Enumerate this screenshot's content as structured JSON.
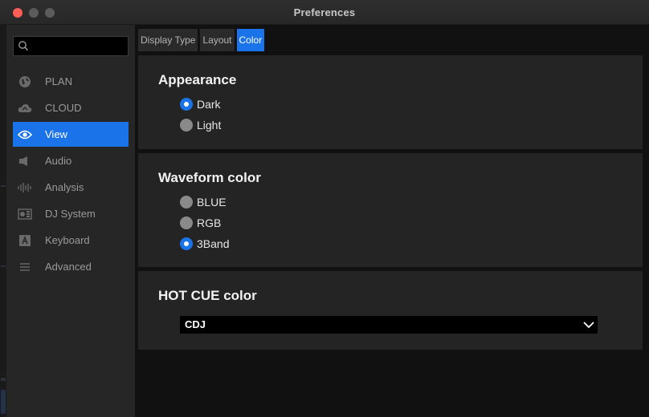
{
  "window": {
    "title": "Preferences"
  },
  "sidebar": {
    "search": {
      "placeholder": "",
      "value": ""
    },
    "items": [
      {
        "label": "PLAN",
        "icon": "globe-icon",
        "active": false
      },
      {
        "label": "CLOUD",
        "icon": "cloud-icon",
        "active": false
      },
      {
        "label": "View",
        "icon": "eye-icon",
        "active": true
      },
      {
        "label": "Audio",
        "icon": "speaker-icon",
        "active": false
      },
      {
        "label": "Analysis",
        "icon": "waveform-icon",
        "active": false
      },
      {
        "label": "DJ System",
        "icon": "dj-device-icon",
        "active": false
      },
      {
        "label": "Keyboard",
        "icon": "keyboard-key-icon",
        "active": false
      },
      {
        "label": "Advanced",
        "icon": "menu-lines-icon",
        "active": false
      }
    ]
  },
  "tabs": [
    {
      "label": "Display Type",
      "active": false
    },
    {
      "label": "Layout",
      "active": false
    },
    {
      "label": "Color",
      "active": true
    }
  ],
  "appearance": {
    "title": "Appearance",
    "options": [
      {
        "label": "Dark",
        "selected": true
      },
      {
        "label": "Light",
        "selected": false
      }
    ]
  },
  "waveform": {
    "title": "Waveform color",
    "options": [
      {
        "label": "BLUE",
        "selected": false
      },
      {
        "label": "RGB",
        "selected": false
      },
      {
        "label": "3Band",
        "selected": true
      }
    ]
  },
  "hotcue": {
    "title": "HOT CUE color",
    "selected": "CDJ"
  },
  "colors": {
    "accent": "#1a73e8",
    "panel": "#242424",
    "sidebar": "#262626"
  }
}
